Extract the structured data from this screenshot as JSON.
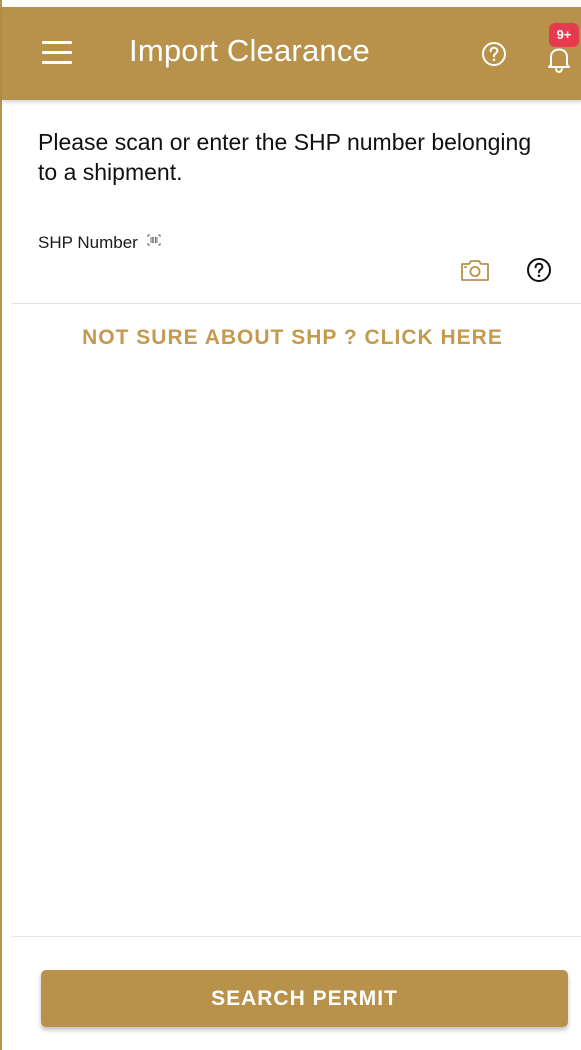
{
  "app_bar": {
    "title": "Import Clearance",
    "menu_icon": "hamburger-menu-icon",
    "help_icon": "question-circle-icon",
    "notification_icon": "bell-icon",
    "notification_badge": "9+",
    "background_color": "#b8924a",
    "badge_color": "#e63a4f"
  },
  "main": {
    "instruction": "Please scan or enter the SHP number belonging to a shipment.",
    "shp_field": {
      "label": "SHP Number",
      "label_icon": "barcode-icon",
      "value": "",
      "placeholder": "",
      "camera_icon": "camera-icon",
      "help_icon": "question-circle-icon"
    },
    "not_sure_link": "NOT SURE ABOUT SHP ? CLICK HERE"
  },
  "footer": {
    "search_button": "SEARCH PERMIT"
  },
  "colors": {
    "accent": "#b8924a",
    "link": "#c29a50"
  }
}
